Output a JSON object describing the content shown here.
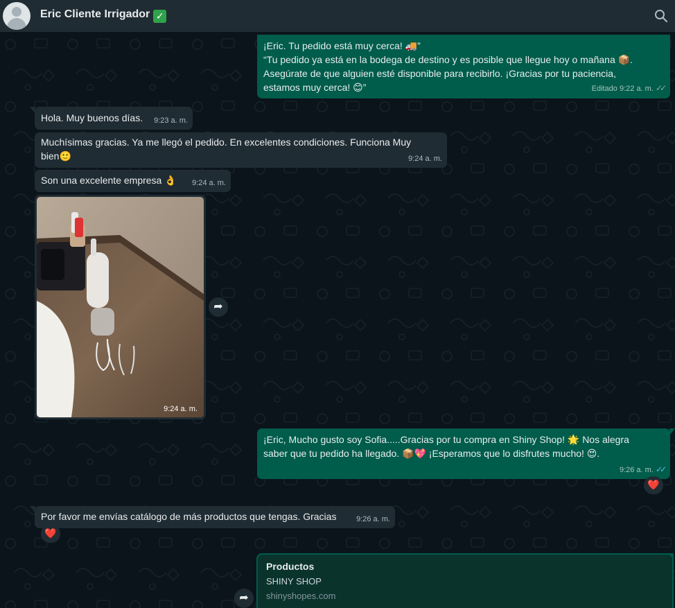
{
  "header": {
    "contact_name": "Eric Cliente Irrigador",
    "verified_icon": "check-mark-button-emoji",
    "search_icon": "search-icon"
  },
  "messages": {
    "m1": {
      "line1": "¡Eric. Tu pedido está muy cerca!  🚚”",
      "line2": "“Tu pedido ya está en la bodega de destino y es posible que llegue hoy o mañana 📦.",
      "line3": "Asegúrate de que alguien esté disponible para recibirlo. ¡Gracias por tu paciencia,",
      "line4": "estamos muy cerca! 😊”",
      "time": "Editado 9:22 a. m."
    },
    "m2": {
      "text": "Hola. Muy buenos días.",
      "time": "9:23 a. m."
    },
    "m3": {
      "line1": "Muchísimas gracias. Ya me llegó el pedido. En excelentes condiciones. Funciona Muy",
      "line2": "bien🙂",
      "time": "9:24 a. m."
    },
    "m4": {
      "text": "Son una excelente empresa 👌",
      "time": "9:24 a. m."
    },
    "m5": {
      "time": "9:24 a. m."
    },
    "m6": {
      "line1": "¡Eric, Mucho gusto soy Sofia.....Gracias por tu compra en Shiny Shop! 🌟 Nos alegra",
      "line2": "saber que tu pedido ha llegado. 📦💖 ¡Esperamos que lo disfrutes mucho! 😍.",
      "time": "9:26 a. m.",
      "reaction": "❤️"
    },
    "m7": {
      "text": "Por favor me envías catálogo de más productos que tengas. Gracias",
      "time": "9:26 a. m.",
      "reaction": "❤️"
    },
    "m8": {
      "title": "Productos",
      "subtitle": "SHINY SHOP",
      "url": "shinyshopes.com"
    }
  },
  "colors": {
    "incoming_bubble": "#202c33",
    "outgoing_bubble": "#005c4b",
    "read_ticks": "#53bdeb",
    "background": "#0b141a"
  }
}
